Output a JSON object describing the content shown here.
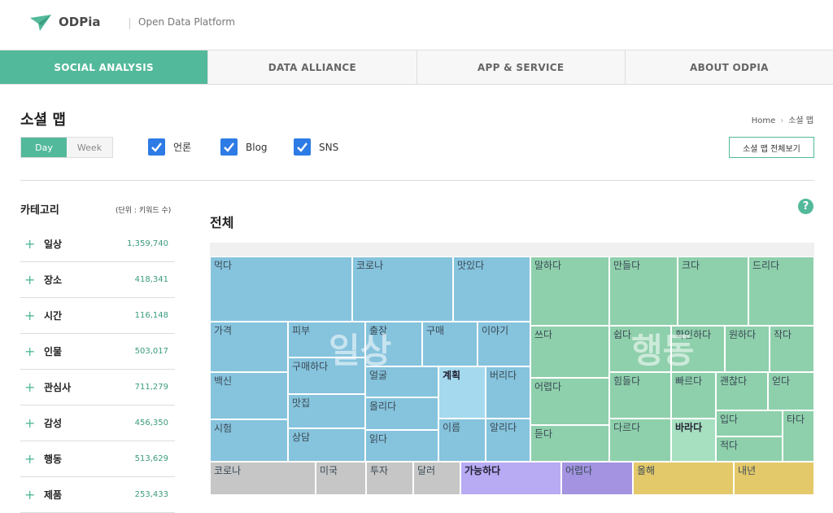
{
  "header": {
    "logo": "ODPia",
    "subtitle": "Open Data Platform"
  },
  "nav": [
    {
      "label": "SOCIAL ANALYSIS",
      "active": true
    },
    {
      "label": "DATA ALLIANCE",
      "active": false
    },
    {
      "label": "APP & SERVICE",
      "active": false
    },
    {
      "label": "ABOUT ODPIA",
      "active": false
    }
  ],
  "page": {
    "title": "소셜 맵",
    "breadcrumb": [
      "Home",
      "소셜 맵"
    ],
    "full_view_button": "소셜 맵 전체보기",
    "main_title": "전체",
    "help": "?"
  },
  "period": {
    "day": "Day",
    "week": "Week",
    "selected": "Day"
  },
  "sources": [
    {
      "label": "언론",
      "checked": true
    },
    {
      "label": "Blog",
      "checked": true
    },
    {
      "label": "SNS",
      "checked": true
    }
  ],
  "category": {
    "heading": "카테고리",
    "unit": "(단위 : 키워드 수)",
    "items": [
      {
        "name": "일상",
        "value": "1,359,740"
      },
      {
        "name": "장소",
        "value": "418,341"
      },
      {
        "name": "시간",
        "value": "116,148"
      },
      {
        "name": "인물",
        "value": "503,017"
      },
      {
        "name": "관심사",
        "value": "711,279"
      },
      {
        "name": "감성",
        "value": "456,350"
      },
      {
        "name": "행동",
        "value": "513,629"
      },
      {
        "name": "제품",
        "value": "253,433"
      }
    ]
  },
  "treemap": {
    "groups": [
      "일상",
      "행동"
    ],
    "cells": {
      "il": [
        "먹다",
        "코로나",
        "맛있다",
        "가격",
        "피부",
        "출장",
        "구매",
        "이야기",
        "구매하다",
        "백신",
        "얼굴",
        "계획",
        "버리다",
        "맛집",
        "올리다",
        "시험",
        "상담",
        "읽다",
        "이름",
        "알리다"
      ],
      "hd": [
        "말하다",
        "만들다",
        "크다",
        "드리다",
        "쓰다",
        "쉽다",
        "확인하다",
        "원하다",
        "작다",
        "어렵다",
        "힘들다",
        "빠르다",
        "괜찮다",
        "얻다",
        "입다",
        "타다",
        "듣다",
        "다르다",
        "바라다",
        "적다"
      ],
      "bottom": [
        "코로나",
        "미국",
        "투자",
        "달러",
        "가능하다",
        "어렵다",
        "올해",
        "내년"
      ]
    }
  }
}
